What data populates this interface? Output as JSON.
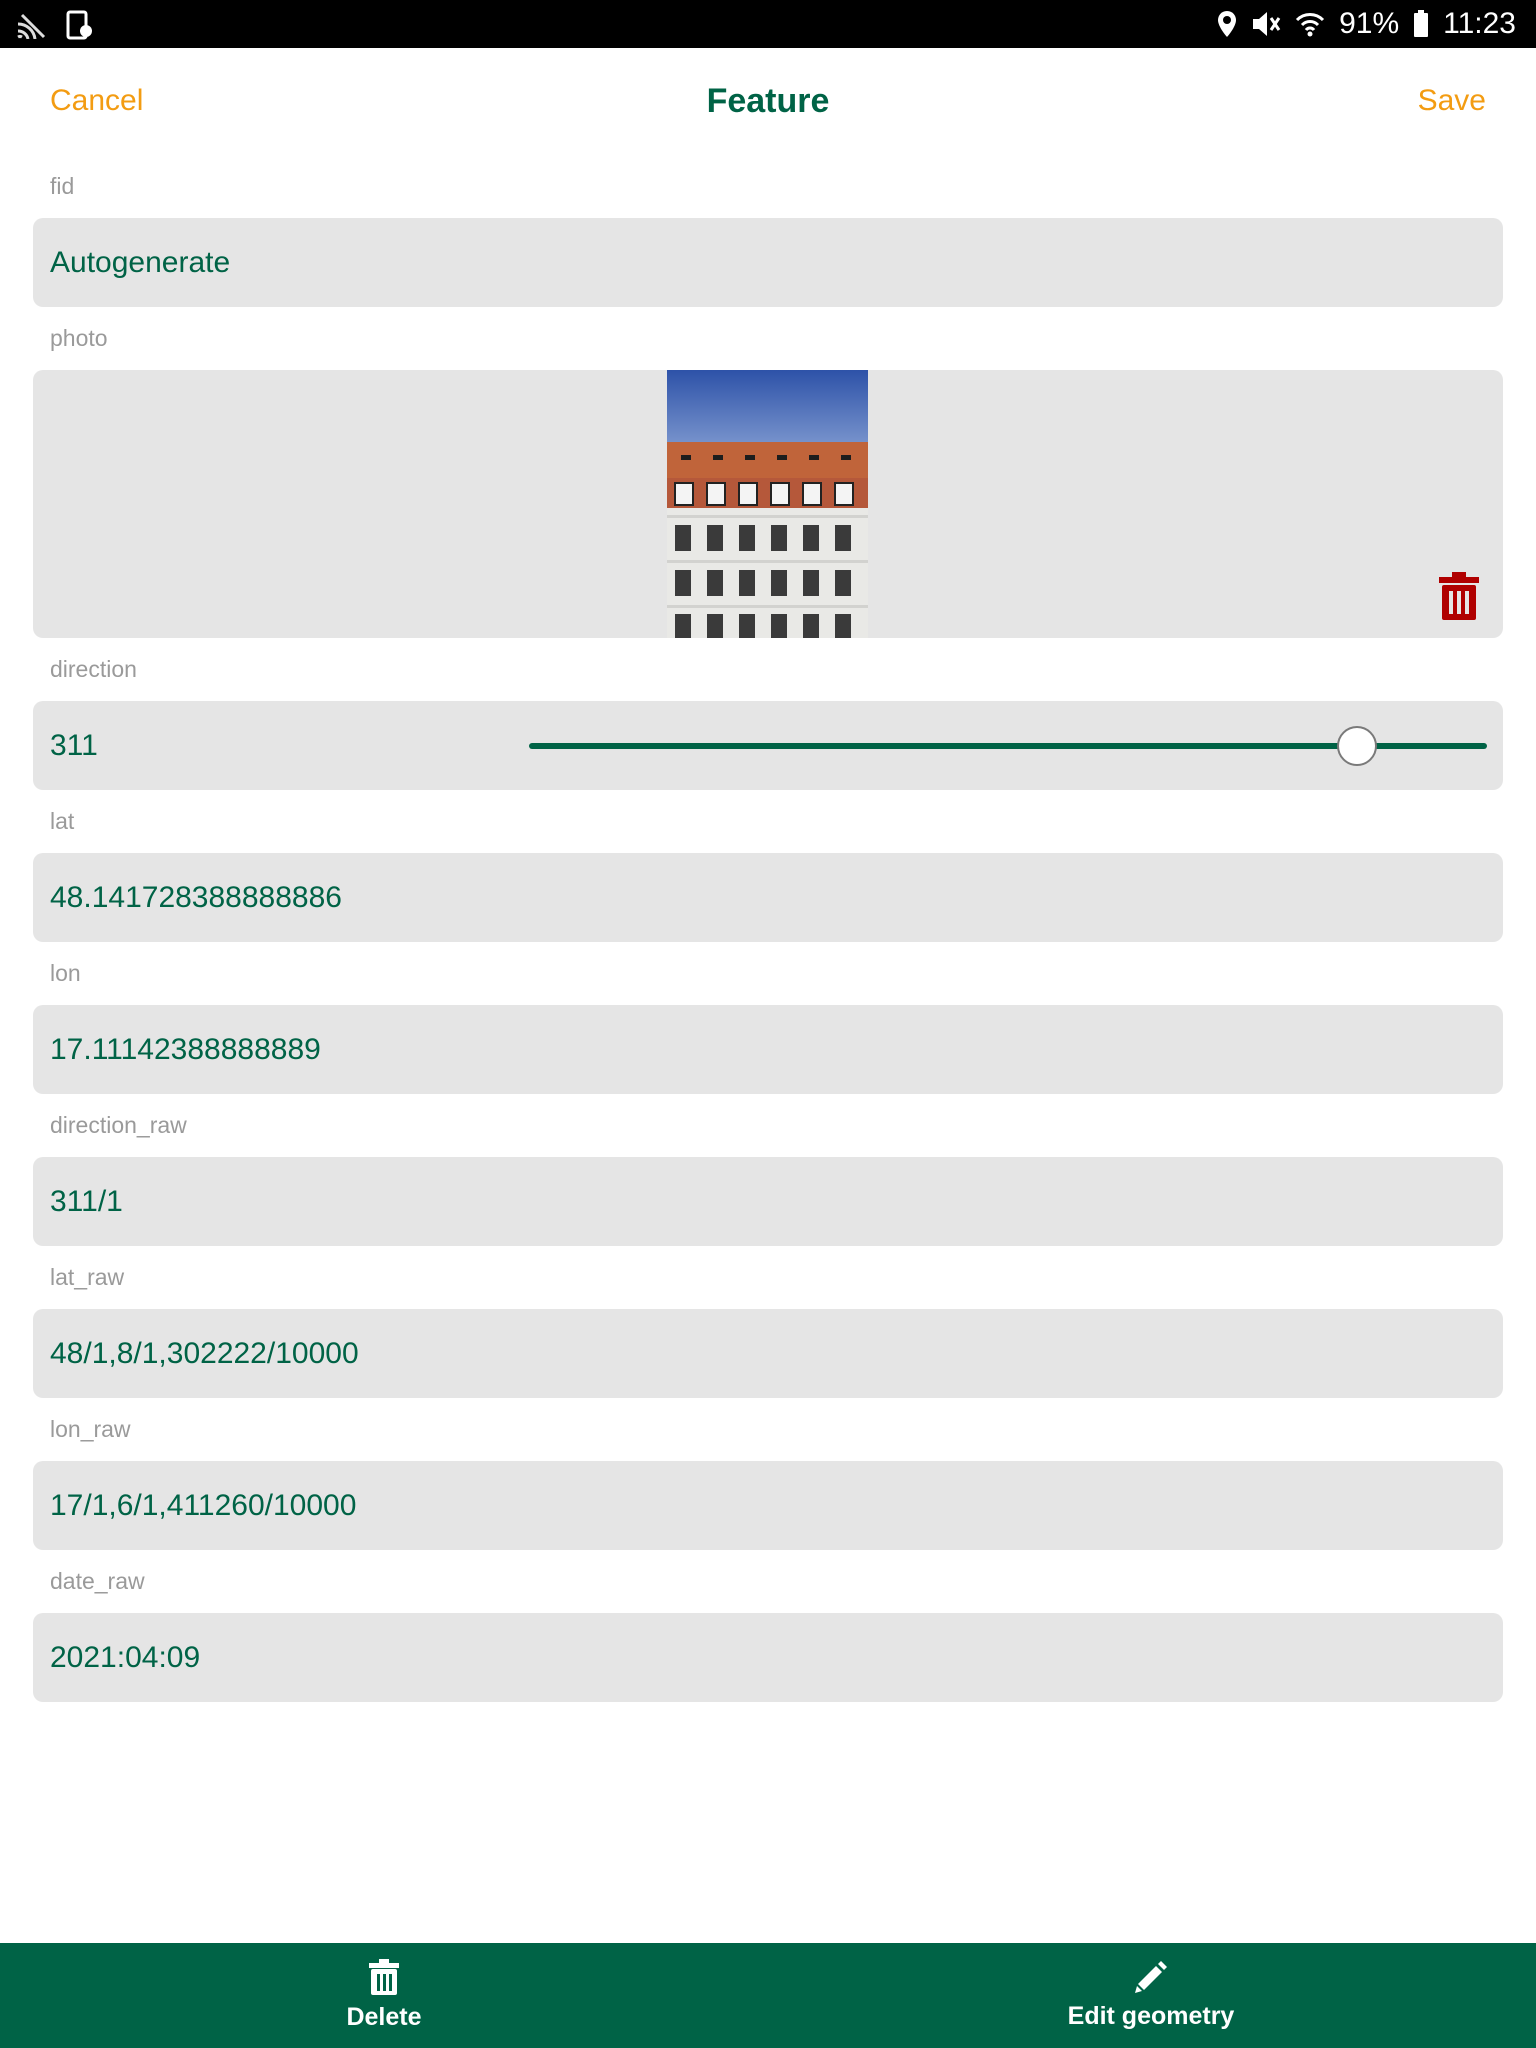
{
  "status_bar": {
    "battery": "91%",
    "time": "11:23",
    "icons": [
      "cast-icon",
      "screenshot-icon",
      "location-icon",
      "mute-icon",
      "wifi-icon",
      "battery-icon"
    ]
  },
  "header": {
    "cancel_label": "Cancel",
    "title": "Feature",
    "save_label": "Save"
  },
  "form": {
    "fid": {
      "label": "fid",
      "value": "Autogenerate"
    },
    "photo": {
      "label": "photo"
    },
    "direction": {
      "label": "direction",
      "value": "311",
      "slider_min": 0,
      "slider_max": 360,
      "slider_value": 311
    },
    "lat": {
      "label": "lat",
      "value": "48.141728388888886"
    },
    "lon": {
      "label": "lon",
      "value": "17.11142388888889"
    },
    "direction_raw": {
      "label": "direction_raw",
      "value": "311/1"
    },
    "lat_raw": {
      "label": "lat_raw",
      "value": "48/1,8/1,302222/10000"
    },
    "lon_raw": {
      "label": "lon_raw",
      "value": "17/1,6/1,411260/10000"
    },
    "date_raw": {
      "label": "date_raw",
      "value": "2021:04:09"
    }
  },
  "bottom_bar": {
    "delete_label": "Delete",
    "edit_geometry_label": "Edit geometry"
  },
  "colors": {
    "accent": "#006346",
    "action": "#f39c12",
    "danger": "#b00000",
    "field_bg": "#e5e5e5"
  }
}
